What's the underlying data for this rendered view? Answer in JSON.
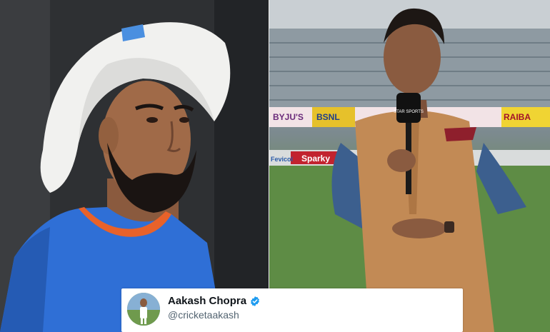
{
  "tweet": {
    "display_name": "Aakash Chopra",
    "handle": "@cricketaakash"
  },
  "photo_right": {
    "boards": [
      "BYJU'S",
      "BSNL",
      "RAIBA",
      "Sparky",
      "Fevicol"
    ],
    "mic_label": "STAR SPORTS"
  },
  "colors": {
    "verified_blue": "#1d9bf0",
    "jersey_blue": "#2f6fd6",
    "jersey_orange": "#e8622a",
    "vest_tan": "#c28a55"
  }
}
